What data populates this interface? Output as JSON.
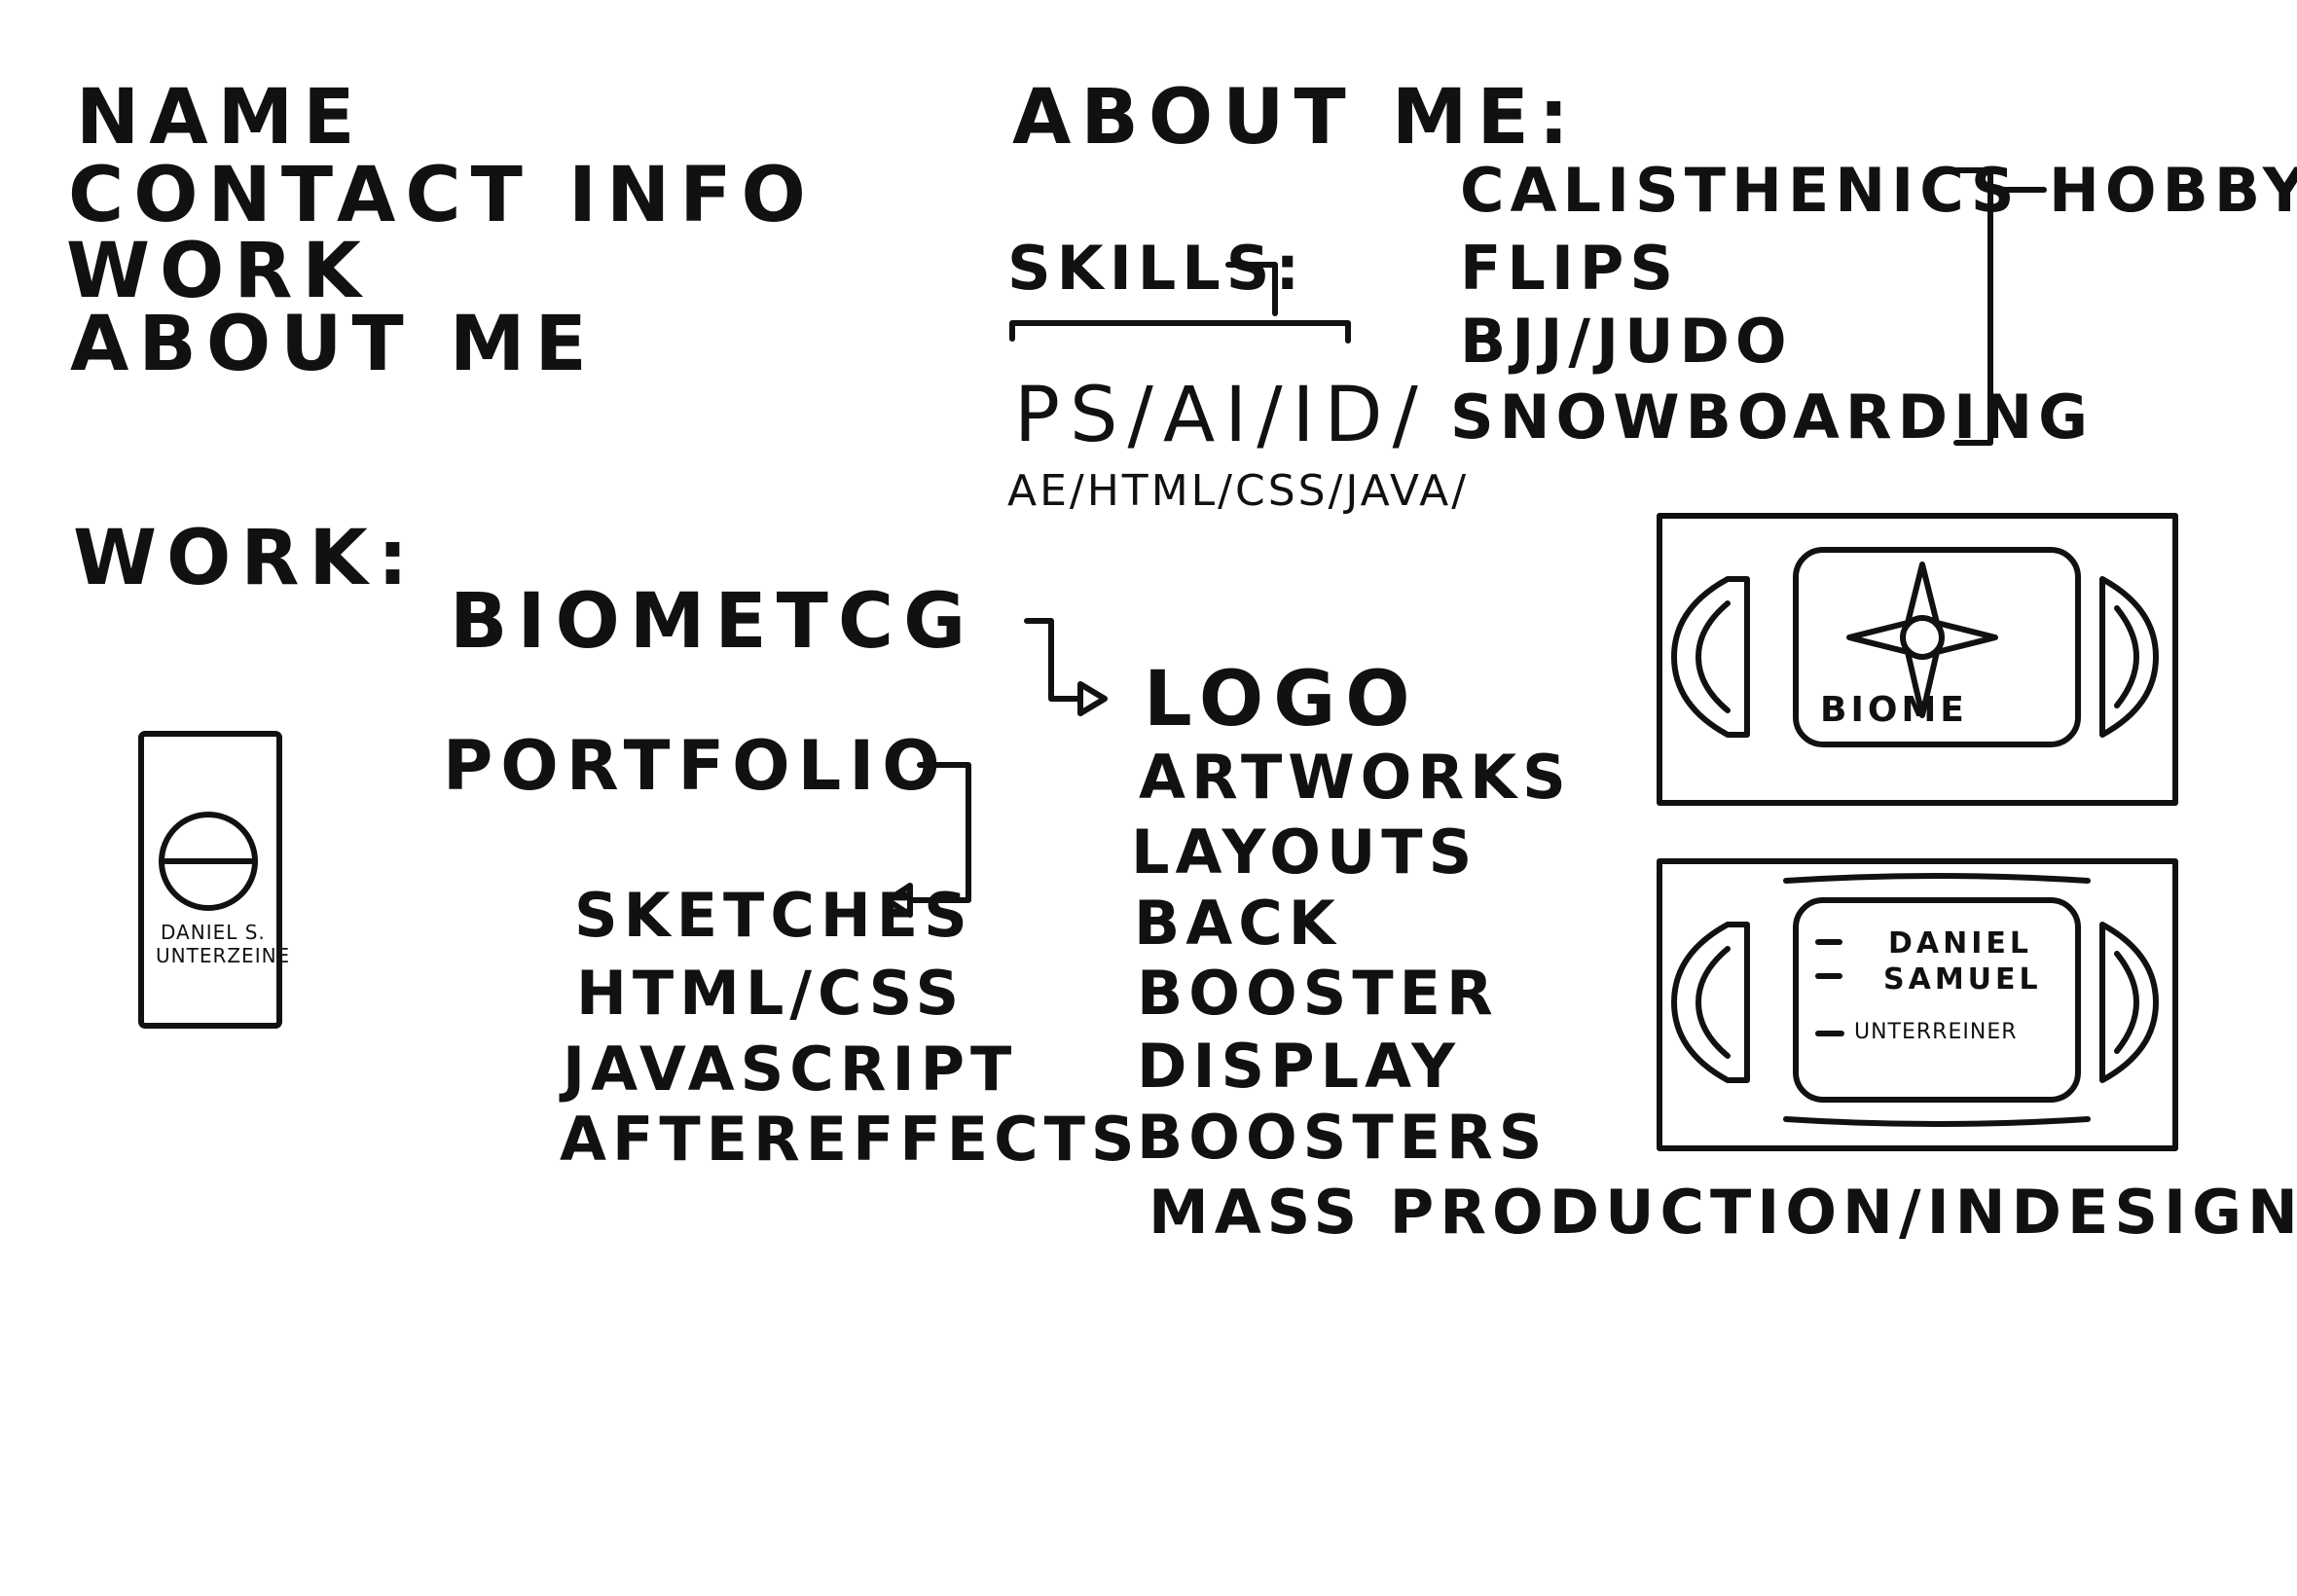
{
  "nav": {
    "items": [
      "NAME",
      "CONTACT INFO",
      "WORK",
      "ABOUT ME"
    ]
  },
  "about": {
    "title": "ABOUT ME:",
    "skills_label": "SKILLS:",
    "skills_line1": "PS/AI/ID/",
    "skills_line2": "AE/HTML/CSS/JAVA/",
    "hobbies": [
      "CALISTHENICS",
      "FLIPS",
      "BJJ/JUDO",
      "SNOWBOARDING"
    ],
    "hobbies_label": "HOBBYS"
  },
  "work": {
    "title": "WORK:",
    "projects": {
      "biometcg": "BIOMETCG",
      "portfolio": "PORTFOLIO"
    },
    "portfolio_items": [
      "SKETCHES",
      "HTML/CSS",
      "JAVASCRIPT",
      "AFTEREFFECTS"
    ],
    "biome_items": [
      "LOGO",
      "ARTWORKS",
      "LAYOUTS",
      "BACK",
      "BOOSTER",
      "DISPLAY",
      "BOOSTERS",
      "MASS PRODUCTION/INDESIGN"
    ]
  },
  "logo_card": {
    "line1": "DANIEL S.",
    "line2": "UNTERZEINE"
  },
  "cards": {
    "biome_label": "BIOME",
    "name_lines": [
      "DANIEL",
      "SAMUEL",
      "UNTERREINER"
    ]
  }
}
